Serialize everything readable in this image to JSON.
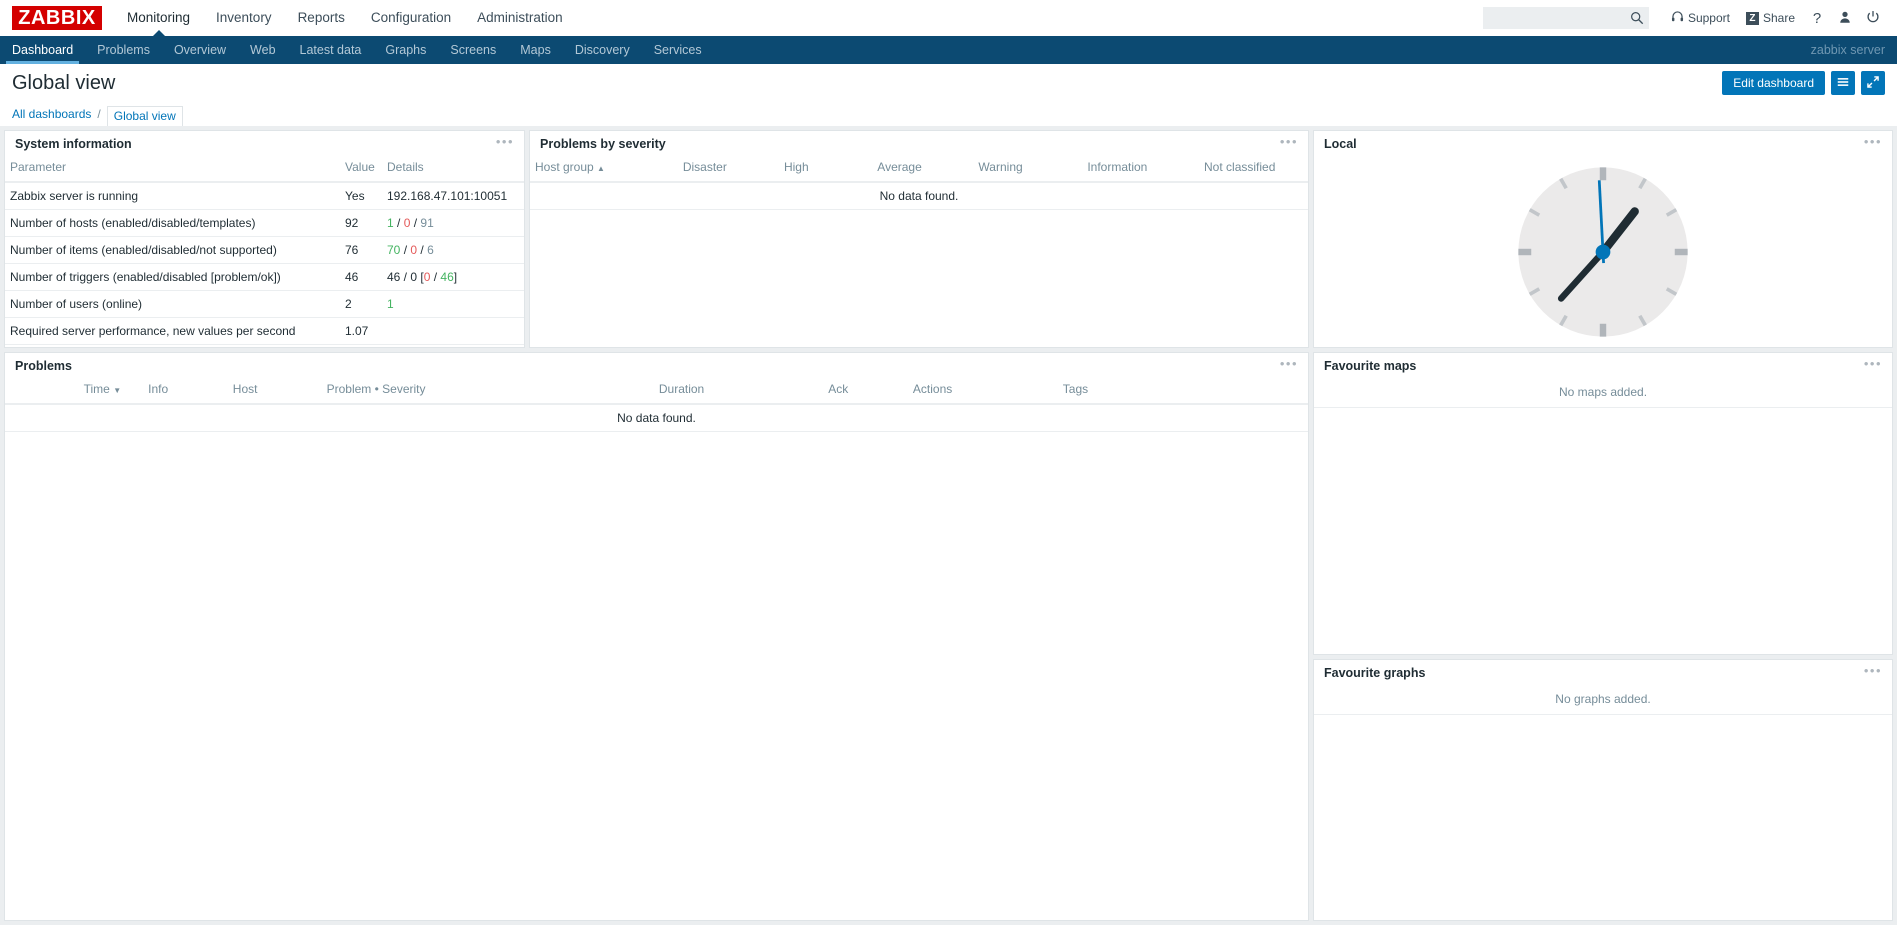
{
  "brand": {
    "logo_text": "ZABBIX",
    "logo_color": "#d40000"
  },
  "accent": {
    "primary": "#0275b8",
    "navbar": "#0c4a72",
    "tab_underline": "#63b1e0"
  },
  "topnav": {
    "items": [
      {
        "label": "Monitoring",
        "selected": true
      },
      {
        "label": "Inventory",
        "selected": false
      },
      {
        "label": "Reports",
        "selected": false
      },
      {
        "label": "Configuration",
        "selected": false
      },
      {
        "label": "Administration",
        "selected": false
      }
    ],
    "search": {
      "value": "",
      "placeholder": "",
      "icon": "search-icon"
    },
    "support_label": "Support",
    "support_icon": "headset-icon",
    "share_label": "Share",
    "share_icon": "zabbix-share-icon",
    "help_icon": "question-mark-icon",
    "user_icon": "user-icon",
    "signout_icon": "power-icon"
  },
  "subnav": {
    "items": [
      {
        "label": "Dashboard",
        "selected": true
      },
      {
        "label": "Problems",
        "selected": false
      },
      {
        "label": "Overview",
        "selected": false
      },
      {
        "label": "Web",
        "selected": false
      },
      {
        "label": "Latest data",
        "selected": false
      },
      {
        "label": "Graphs",
        "selected": false
      },
      {
        "label": "Screens",
        "selected": false
      },
      {
        "label": "Maps",
        "selected": false
      },
      {
        "label": "Discovery",
        "selected": false
      },
      {
        "label": "Services",
        "selected": false
      }
    ],
    "user": "zabbix server"
  },
  "page": {
    "title": "Global view",
    "edit_label": "Edit dashboard",
    "menu_icon": "hamburger-icon",
    "fullscreen_icon": "expand-icon"
  },
  "breadcrumb": {
    "all_dashboards": "All dashboards",
    "separator": "/",
    "current": "Global view"
  },
  "widgets": {
    "system_information": {
      "title": "System information",
      "menu": "•••",
      "columns": [
        "Parameter",
        "Value",
        "Details"
      ],
      "rows": [
        {
          "parameter": "Zabbix server is running",
          "value": "Yes",
          "value_class": "green-d",
          "details_parts": [
            {
              "text": "192.168.47.101:10051",
              "cls": ""
            }
          ]
        },
        {
          "parameter": "Number of hosts (enabled/disabled/templates)",
          "value": "92",
          "value_class": "",
          "details_parts": [
            {
              "text": "1",
              "cls": "green-d"
            },
            {
              "text": " / ",
              "cls": ""
            },
            {
              "text": "0",
              "cls": "red"
            },
            {
              "text": " / ",
              "cls": ""
            },
            {
              "text": "91",
              "cls": "grey"
            }
          ]
        },
        {
          "parameter": "Number of items (enabled/disabled/not supported)",
          "value": "76",
          "value_class": "",
          "details_parts": [
            {
              "text": "70",
              "cls": "green-d"
            },
            {
              "text": " / ",
              "cls": ""
            },
            {
              "text": "0",
              "cls": "red"
            },
            {
              "text": " / ",
              "cls": ""
            },
            {
              "text": "6",
              "cls": "grey"
            }
          ]
        },
        {
          "parameter": "Number of triggers (enabled/disabled [problem/ok])",
          "value": "46",
          "value_class": "",
          "details_parts": [
            {
              "text": "46 / 0 [",
              "cls": ""
            },
            {
              "text": "0",
              "cls": "red"
            },
            {
              "text": " / ",
              "cls": ""
            },
            {
              "text": "46",
              "cls": "green-d"
            },
            {
              "text": "]",
              "cls": ""
            }
          ]
        },
        {
          "parameter": "Number of users (online)",
          "value": "2",
          "value_class": "",
          "details_parts": [
            {
              "text": "1",
              "cls": "green-d"
            }
          ]
        },
        {
          "parameter": "Required server performance, new values per second",
          "value": "1.07",
          "value_class": "",
          "details_parts": []
        }
      ]
    },
    "problems_by_severity": {
      "title": "Problems by severity",
      "menu": "•••",
      "columns": [
        "Host group",
        "Disaster",
        "High",
        "Average",
        "Warning",
        "Information",
        "Not classified"
      ],
      "sorted_column": "Host group",
      "sort_direction": "asc",
      "sort_glyph": "▲",
      "empty_text": "No data found."
    },
    "local_clock": {
      "title": "Local",
      "menu": "•••",
      "type": "analog-clock",
      "hour_angle_deg": 38,
      "minute_angle_deg": 222,
      "second_angle_deg": 357,
      "hand_color": "#1f2c33",
      "second_hand_color": "#0275b8",
      "face_color": "#ebeaea"
    },
    "problems": {
      "title": "Problems",
      "menu": "•••",
      "columns": [
        "Time",
        "Info",
        "Host",
        "Problem • Severity",
        "Duration",
        "Ack",
        "Actions",
        "Tags"
      ],
      "sorted_column": "Time",
      "sort_direction": "desc",
      "sort_glyph": "▼",
      "empty_text": "No data found."
    },
    "favourite_maps": {
      "title": "Favourite maps",
      "menu": "•••",
      "empty_text": "No maps added."
    },
    "favourite_graphs": {
      "title": "Favourite graphs",
      "menu": "•••",
      "empty_text": "No graphs added."
    }
  }
}
